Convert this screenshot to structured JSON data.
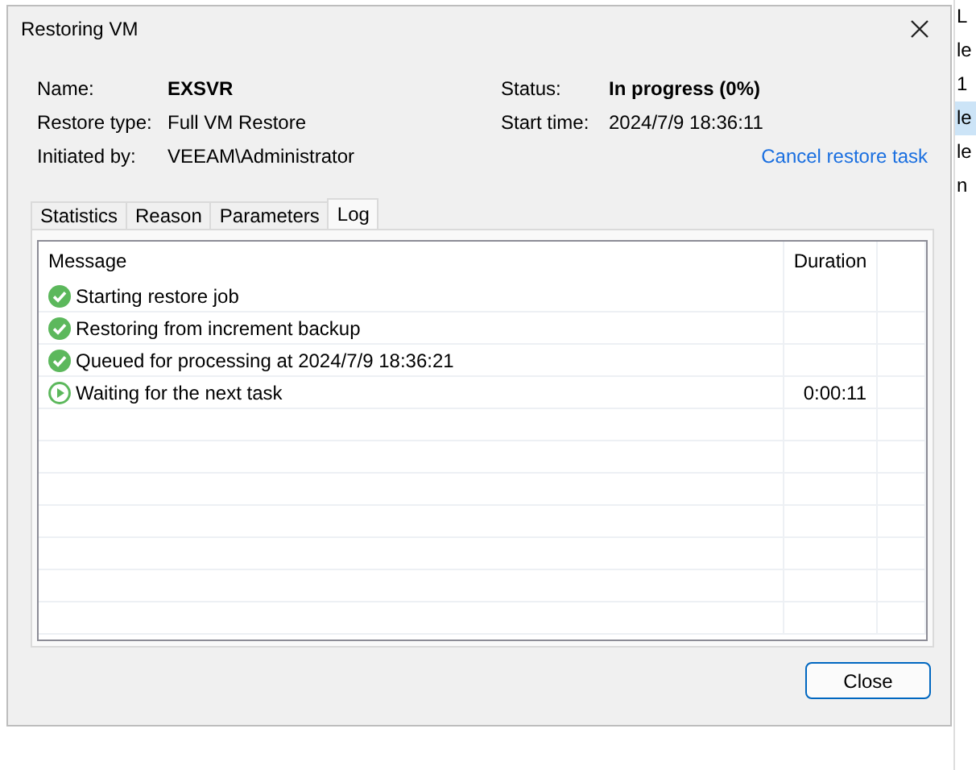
{
  "background_list": [
    {
      "text": "L",
      "selected": false
    },
    {
      "text": "le",
      "selected": false
    },
    {
      "text": "1",
      "selected": false
    },
    {
      "text": "le",
      "selected": true
    },
    {
      "text": "le",
      "selected": false
    },
    {
      "text": "n",
      "selected": false
    }
  ],
  "dialog": {
    "title": "Restoring VM",
    "info_left": [
      {
        "label": "Name:",
        "value": "EXSVR",
        "bold": true
      },
      {
        "label": "Restore type:",
        "value": "Full VM Restore",
        "bold": false
      },
      {
        "label": "Initiated by:",
        "value": "VEEAM\\Administrator",
        "bold": false
      }
    ],
    "info_right": [
      {
        "label": "Status:",
        "value": "In progress (0%)",
        "bold": true
      },
      {
        "label": "Start time:",
        "value": "2024/7/9 18:36:11",
        "bold": false
      }
    ],
    "cancel_link": "Cancel restore task",
    "tabs": [
      {
        "label": "Statistics",
        "selected": false
      },
      {
        "label": "Reason",
        "selected": false
      },
      {
        "label": "Parameters",
        "selected": false
      },
      {
        "label": "Log",
        "selected": true
      }
    ],
    "log": {
      "columns": [
        "Message",
        "Duration"
      ],
      "rows": [
        {
          "kind": "done",
          "message": "Starting restore job"
        },
        {
          "kind": "done",
          "message": "Restoring from increment backup"
        },
        {
          "kind": "done",
          "message": "Queued for processing at 2024/7/9 18:36:21"
        },
        {
          "kind": "running",
          "message": "Waiting for the next task",
          "duration": "0:00:11"
        }
      ]
    },
    "close_button": "Close"
  }
}
